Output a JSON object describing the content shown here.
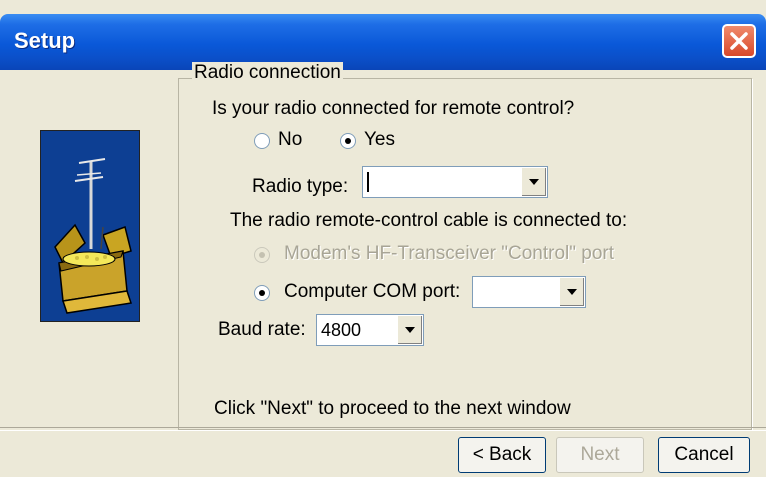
{
  "window": {
    "title": "Setup"
  },
  "group": {
    "legend": "Radio connection",
    "question": "Is your radio connected for remote control?",
    "options": [
      {
        "label": "No",
        "checked": false
      },
      {
        "label": "Yes",
        "checked": true
      }
    ],
    "radio_type": {
      "label": "Radio type:",
      "value": ""
    },
    "cable": {
      "prompt": "The radio remote-control cable is connected to:",
      "modem_option": "Modem's HF-Transceiver \"Control\" port",
      "com_option": "Computer COM port:",
      "com_value": ""
    },
    "baud": {
      "label": "Baud rate:",
      "value": "4800"
    },
    "hint": "Click \"Next\" to proceed to the next window"
  },
  "buttons": {
    "back": "< Back",
    "next": "Next",
    "cancel": "Cancel"
  },
  "colors": {
    "titlebar": "#0a58d8",
    "face": "#ece9d8",
    "image_background": "#0d3f93"
  },
  "icons": {
    "close": "close-icon",
    "dropdown": "chevron-down-icon",
    "wizard_picture": "radio-box-antenna-icon"
  }
}
